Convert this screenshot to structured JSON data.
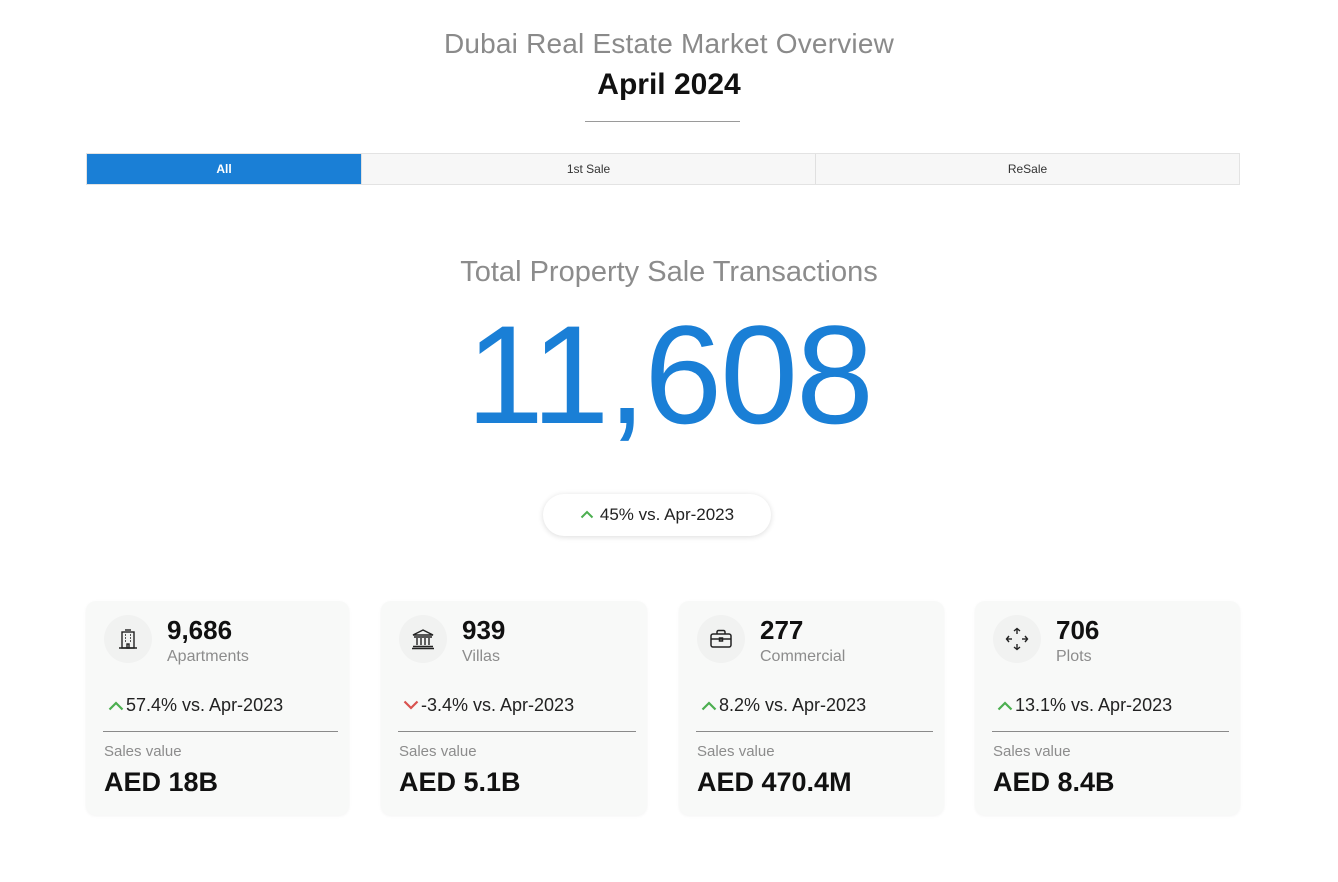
{
  "header": {
    "title": "Dubai Real Estate Market Overview",
    "subtitle": "April 2024"
  },
  "tabs": [
    {
      "label": "All",
      "active": true
    },
    {
      "label": "1st Sale",
      "active": false
    },
    {
      "label": "ReSale",
      "active": false
    }
  ],
  "kpi": {
    "label": "Total Property Sale Transactions",
    "value": "11,608",
    "change": "45% vs. Apr-2023",
    "trend": "up"
  },
  "cards": [
    {
      "icon": "building-icon",
      "count": "9,686",
      "type": "Apartments",
      "change": "57.4% vs. Apr-2023",
      "trend": "up",
      "sales_label": "Sales value",
      "sales_value": "AED 18B"
    },
    {
      "icon": "villa-icon",
      "count": "939",
      "type": "Villas",
      "change": "-3.4% vs. Apr-2023",
      "trend": "down",
      "sales_label": "Sales value",
      "sales_value": "AED 5.1B"
    },
    {
      "icon": "briefcase-icon",
      "count": "277",
      "type": "Commercial",
      "change": "8.2% vs. Apr-2023",
      "trend": "up",
      "sales_label": "Sales value",
      "sales_value": "AED 470.4M"
    },
    {
      "icon": "expand-arrows-icon",
      "count": "706",
      "type": "Plots",
      "change": "13.1% vs. Apr-2023",
      "trend": "up",
      "sales_label": "Sales value",
      "sales_value": "AED 8.4B"
    }
  ],
  "colors": {
    "accent": "#1a7fd6",
    "up": "#4caf50",
    "down": "#d9534f",
    "muted": "#8c8c8c"
  }
}
